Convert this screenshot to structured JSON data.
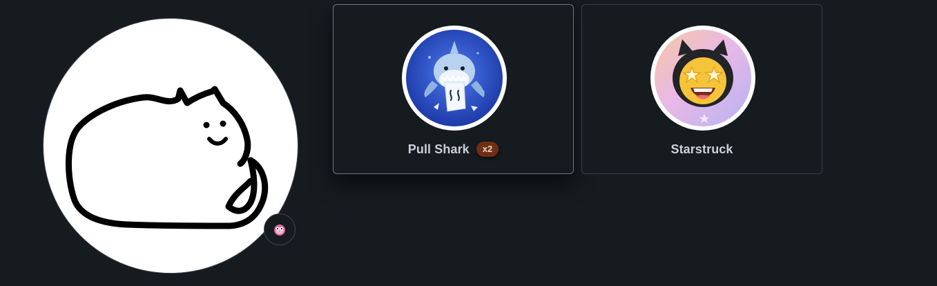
{
  "profile": {
    "avatar_icon": "lying-cat-doodle-icon",
    "status_emoji_icon": "pink-owl-emoji-icon"
  },
  "achievements": [
    {
      "title": "Pull Shark",
      "tier": "x2",
      "badge_icon": "pull-shark-badge-icon",
      "tier_color": "#6e2f14"
    },
    {
      "title": "Starstruck",
      "badge_icon": "starstruck-badge-icon"
    }
  ],
  "colors": {
    "background": "#161b20",
    "card_border": "#3a4048",
    "text": "#c9d1d9"
  }
}
